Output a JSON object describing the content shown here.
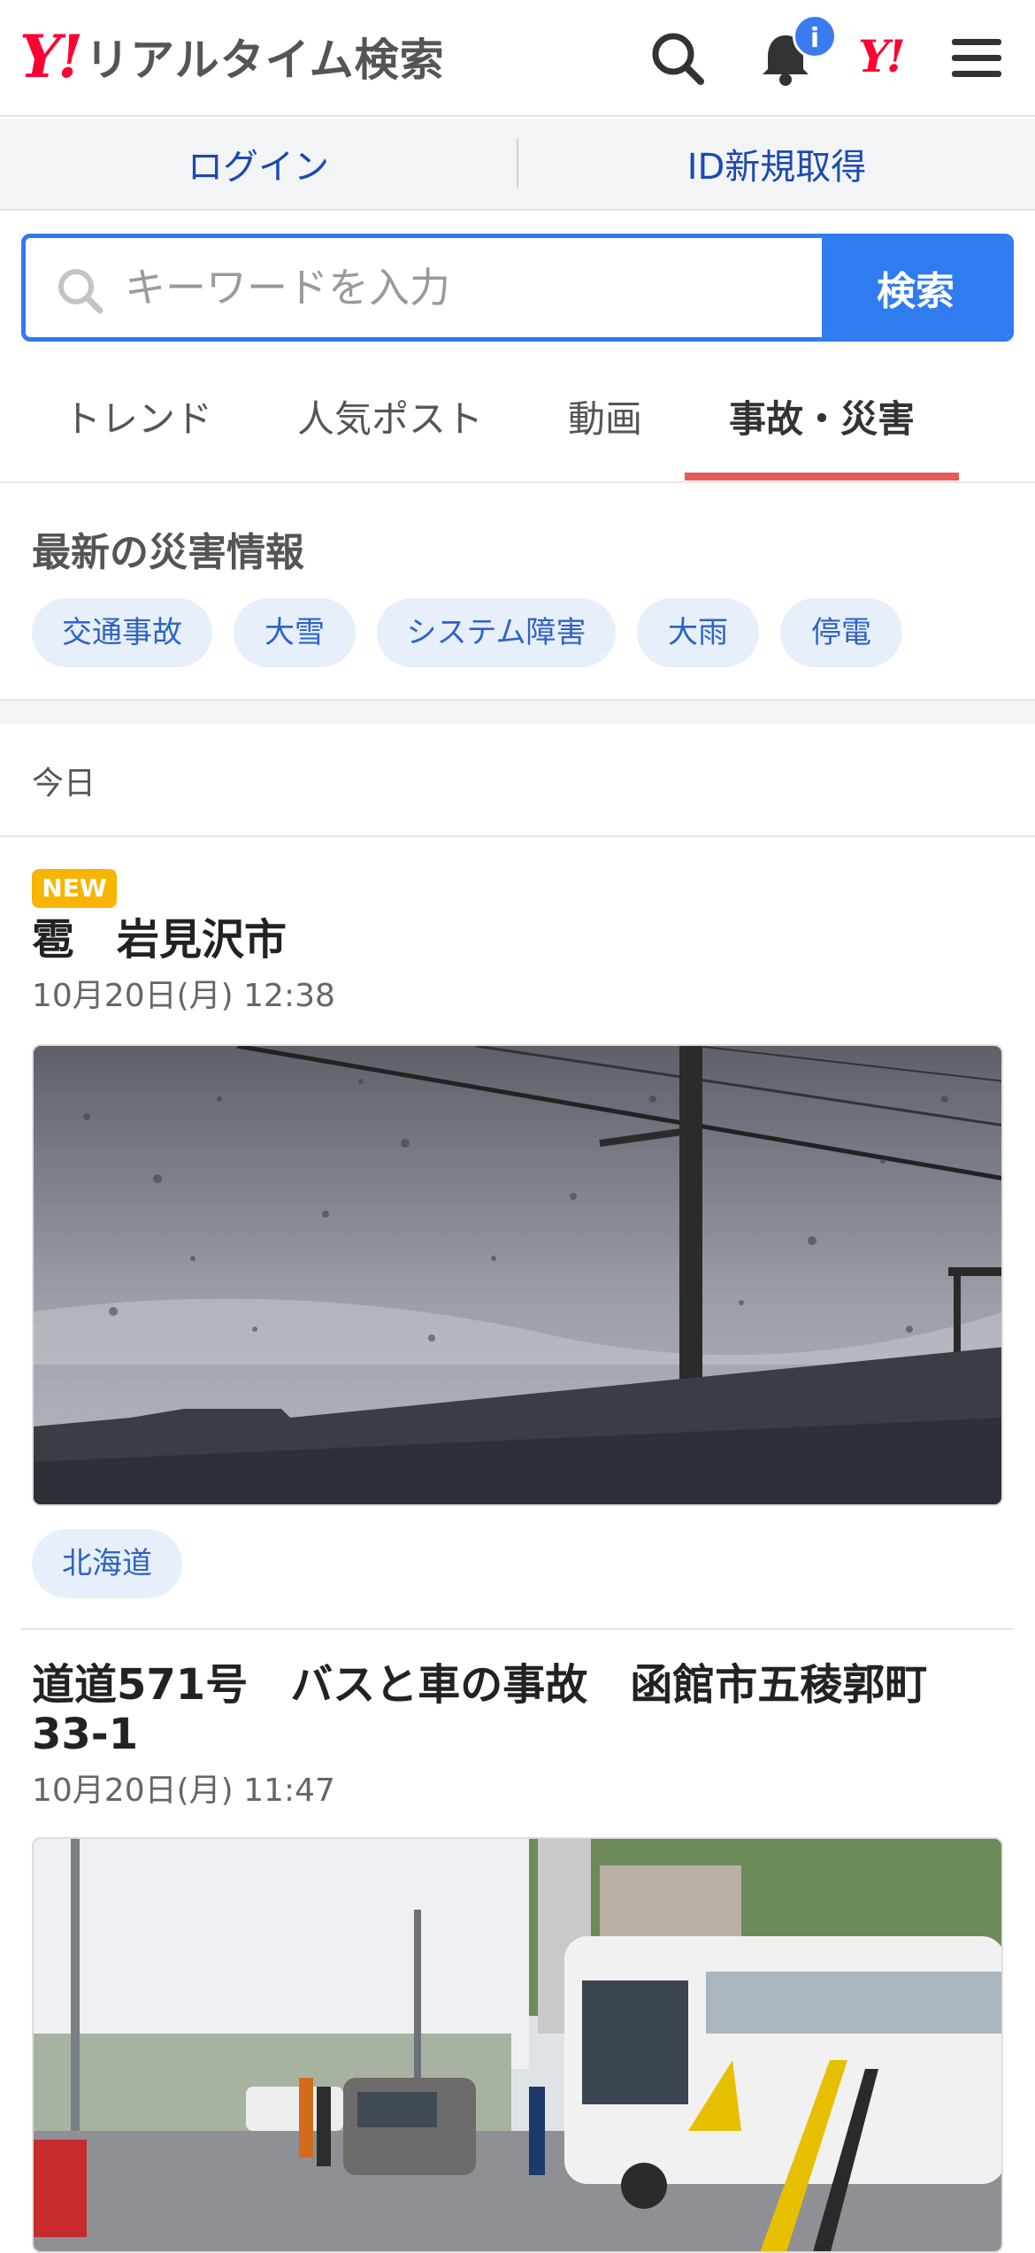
{
  "header": {
    "logo_mark": "Y!",
    "logo_text": "リアルタイム検索",
    "notification_badge": "i",
    "yahoo_japan_mark": "Y!",
    "icons": [
      "search-icon",
      "bell-icon",
      "yahoo-logo-icon",
      "menu-icon"
    ]
  },
  "account": {
    "login_label": "ログイン",
    "signup_label": "ID新規取得"
  },
  "search": {
    "placeholder": "キーワードを入力",
    "value": "",
    "button_label": "検索"
  },
  "tabs": [
    {
      "label": "トレンド",
      "active": false
    },
    {
      "label": "人気ポスト",
      "active": false
    },
    {
      "label": "動画",
      "active": false
    },
    {
      "label": "事故・災害",
      "active": true
    }
  ],
  "disaster_info": {
    "title": "最新の災害情報",
    "chips": [
      "交通事故",
      "大雪",
      "システム障害",
      "大雨",
      "停電"
    ]
  },
  "feed": {
    "date_heading": "今日",
    "posts": [
      {
        "badge": "NEW",
        "title": "雹　岩見沢市",
        "time": "10月20日(月) 12:38",
        "location": "北海道"
      },
      {
        "title": "道道571号　バスと車の事故　函館市五稜郭町33-1",
        "time": "10月20日(月) 11:47"
      }
    ]
  },
  "colors": {
    "brand_red": "#ff0033",
    "accent_blue": "#2f7bf0",
    "tab_underline": "#e65a5a",
    "new_badge": "#f7b500",
    "link_blue": "#1a4ab0"
  }
}
